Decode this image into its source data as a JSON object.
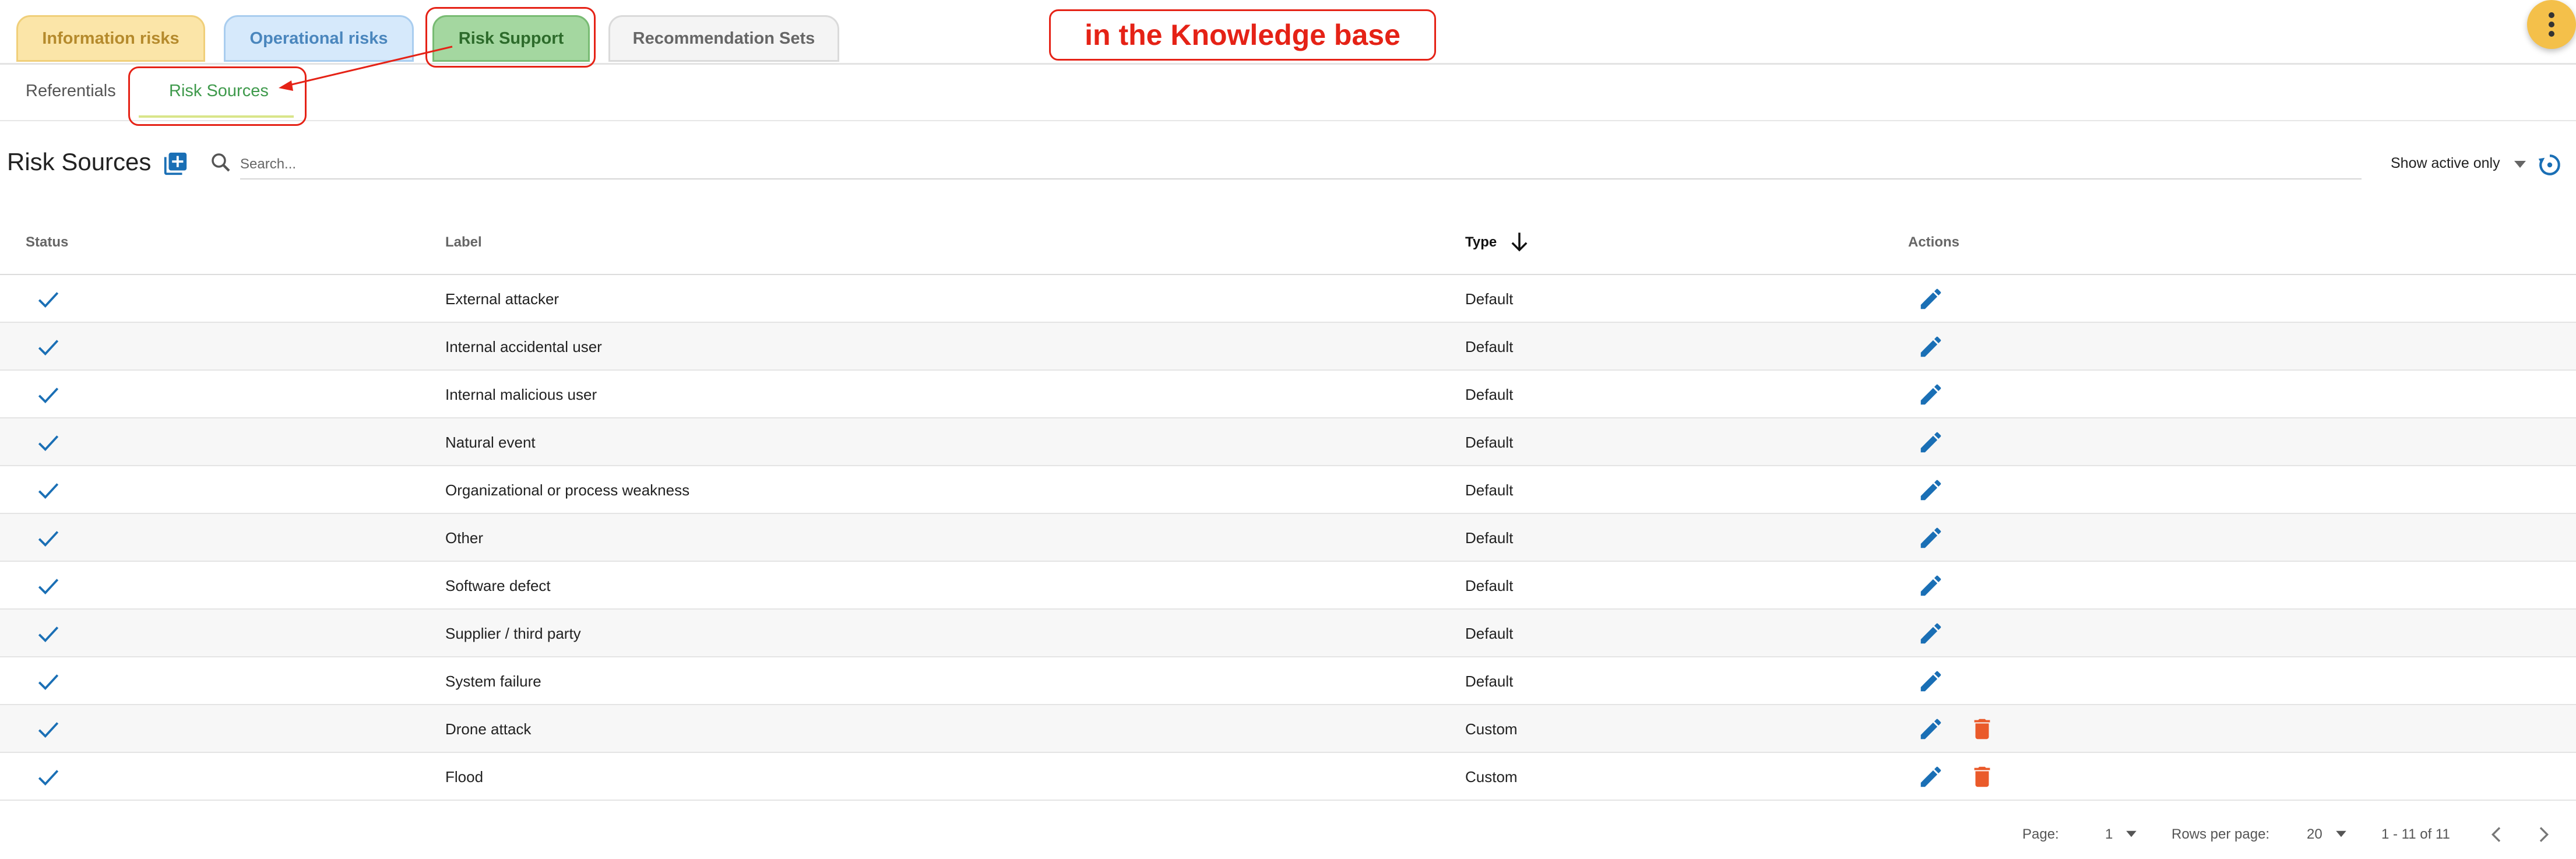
{
  "top_tabs": [
    {
      "label": "Information risks"
    },
    {
      "label": "Operational risks"
    },
    {
      "label": "Risk Support"
    },
    {
      "label": "Recommendation Sets"
    }
  ],
  "annotation": "in the Knowledge base",
  "sub_tabs": [
    {
      "label": "Referentials"
    },
    {
      "label": "Risk Sources"
    }
  ],
  "toolbar": {
    "title": "Risk Sources",
    "search_placeholder": "Search...",
    "filter": "Show active only"
  },
  "columns": {
    "status": "Status",
    "label": "Label",
    "type": "Type",
    "actions": "Actions"
  },
  "rows": [
    {
      "label": "External attacker",
      "type": "Default"
    },
    {
      "label": "Internal accidental user",
      "type": "Default"
    },
    {
      "label": "Internal malicious user",
      "type": "Default"
    },
    {
      "label": "Natural event",
      "type": "Default"
    },
    {
      "label": "Organizational or process weakness",
      "type": "Default"
    },
    {
      "label": "Other",
      "type": "Default"
    },
    {
      "label": "Software defect",
      "type": "Default"
    },
    {
      "label": "Supplier / third party",
      "type": "Default"
    },
    {
      "label": "System failure",
      "type": "Default"
    },
    {
      "label": "Drone attack",
      "type": "Custom"
    },
    {
      "label": "Flood",
      "type": "Custom"
    }
  ],
  "pagination": {
    "page_label": "Page:",
    "page": "1",
    "rows_label": "Rows per page:",
    "rows_per_page": "20",
    "range": "1 - 11 of 11"
  },
  "colors": {
    "accent_blue": "#1a6fb5",
    "delete_red": "#ea5a2a",
    "annotation_red": "#e52216",
    "active_tab_green": "#a4d7a0"
  }
}
